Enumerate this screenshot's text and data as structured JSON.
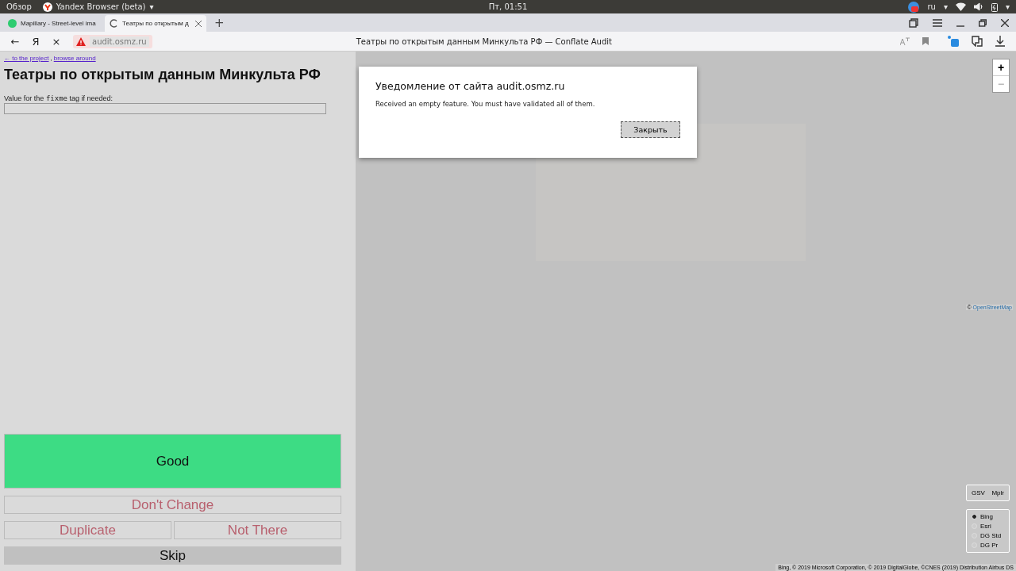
{
  "system_bar": {
    "activities": "Обзор",
    "app_name": "Yandex Browser (beta)",
    "app_caret": "▾",
    "clock": "Пт, 01:51",
    "language": "ru",
    "language_caret": "▾",
    "status_caret": "▾"
  },
  "tabs": [
    {
      "label": "Mapillary - Street-level ima",
      "selected": false
    },
    {
      "label": "Театры по открытым д",
      "selected": true
    }
  ],
  "new_tab": "+",
  "address_bar": {
    "back": "←",
    "home": "Я",
    "stop": "×",
    "url": "audit.osmz.ru",
    "page_title": "Театры по открытым данным Минкульта РФ — Conflate Audit"
  },
  "panel": {
    "links": [
      {
        "label": "← to the project"
      },
      {
        "label": "browse around"
      }
    ],
    "link_separator": ",",
    "title": "Театры по открытым данным Минкульта РФ",
    "fixme_label": [
      {
        "text": "Value for the ",
        "kind": "plain"
      },
      {
        "text": "fixme",
        "kind": "code"
      },
      {
        "text": " tag if needed:",
        "kind": "plain"
      }
    ],
    "buttons": [
      {
        "label": "Good",
        "kind": "good",
        "disabled": false
      },
      {
        "label": "Don't Change",
        "kind": "plain",
        "disabled": true
      },
      {
        "label": "Duplicate",
        "kind": "half",
        "disabled": true
      },
      {
        "label": "Not There",
        "kind": "half",
        "disabled": true
      },
      {
        "label": "Skip",
        "kind": "skip",
        "disabled": false
      }
    ]
  },
  "map": {
    "zoom_in": "+",
    "zoom_out": "−",
    "osm_prefix": "©",
    "osm_link": "OpenStreetMap",
    "street_buttons": [
      "GSV",
      "Mplr"
    ],
    "layers": [
      {
        "label": "Bing",
        "selected": true
      },
      {
        "label": "Esri",
        "selected": false
      },
      {
        "label": "DG Std",
        "selected": false
      },
      {
        "label": "DG Pr",
        "selected": false
      }
    ],
    "attribution": "Bing, © 2019 Microsoft Corporation, © 2019 DigitalGlobe, ©CNES (2019) Distribution Airbus DS"
  },
  "dialog": {
    "title": "Уведомление от сайта audit.osmz.ru",
    "message": "Received an empty feature. You must have validated all of them.",
    "button": "Закрыть"
  }
}
